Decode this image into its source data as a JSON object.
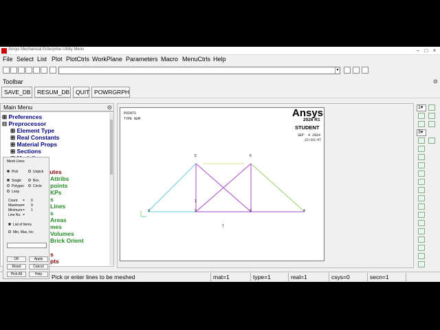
{
  "window": {
    "title": "Ansys Mechanical Enterprise Utility Menu",
    "controls": [
      "–",
      "□",
      "×"
    ]
  },
  "menubar": [
    "File",
    "Select",
    "List",
    "Plot",
    "PlotCtrls",
    "WorkPlane",
    "Parameters",
    "Macro",
    "MenuCtrls",
    "Help"
  ],
  "command_input": {
    "value": ""
  },
  "toolbar": {
    "label": "Toolbar",
    "buttons": [
      "SAVE_DB",
      "RESUM_DB",
      "QUIT",
      "POWRGRPH"
    ]
  },
  "main_menu": {
    "title": "Main Menu",
    "collapse_icon": "⊙",
    "items": [
      {
        "prefix": "⊞",
        "label": "Preferences",
        "color": "#000080"
      },
      {
        "prefix": "⊟",
        "label": "Preprocessor",
        "color": "#000080"
      },
      {
        "prefix": "⊞",
        "label": "Element Type",
        "color": "#000080"
      },
      {
        "prefix": "⊞",
        "label": "Real Constants",
        "color": "#000080"
      },
      {
        "prefix": "⊞",
        "label": "Material Props",
        "color": "#000080"
      },
      {
        "prefix": "⊞",
        "label": "Sections",
        "color": "#000080"
      },
      {
        "prefix": "⊟",
        "label": "Modeling",
        "color": "#000080"
      },
      {
        "prefix": "",
        "label": "butes",
        "color": "#800000"
      },
      {
        "prefix": "",
        "label": "Attribs",
        "color": "#228B22"
      },
      {
        "prefix": "",
        "label": "points",
        "color": "#228B22"
      },
      {
        "prefix": "",
        "label": "KPs",
        "color": "#228B22"
      },
      {
        "prefix": "",
        "label": "s",
        "color": "#228B22"
      },
      {
        "prefix": "",
        "label": "Lines",
        "color": "#228B22"
      },
      {
        "prefix": "",
        "label": "s",
        "color": "#228B22"
      },
      {
        "prefix": "",
        "label": "Areas",
        "color": "#228B22"
      },
      {
        "prefix": "",
        "label": "mes",
        "color": "#228B22"
      },
      {
        "prefix": "",
        "label": "Volumes",
        "color": "#228B22"
      },
      {
        "prefix": "",
        "label": "Brick Orient",
        "color": "#228B22"
      },
      {
        "prefix": "",
        "label": "s",
        "color": "#800000"
      },
      {
        "prefix": "",
        "label": "pts",
        "color": "#800000"
      }
    ]
  },
  "mesh_dialog": {
    "title": "Mesh Lines",
    "pick": "Pick",
    "unpick": "Unpick",
    "single": "Single",
    "box": "Box",
    "polygon": "Polygon",
    "circle": "Circle",
    "loop": "Loop",
    "count_label": "Count",
    "count_value": "0",
    "maximum_label": "Maximum",
    "maximum_value": "9",
    "minimum_label": "Minimum",
    "minimum_value": "1",
    "line_no_label": "Line No.",
    "list_of_items": "List of Items",
    "min_max_inc": "Min, Max, Inc",
    "ok": "OK",
    "apply": "Apply",
    "reset": "Reset",
    "cancel": "Cancel",
    "pick_all": "Pick All",
    "help": "Help"
  },
  "graphics": {
    "top_left_1": "POINTS",
    "top_left_2": "TYPE NUM",
    "brand": "Ansys",
    "version": "2026 R1",
    "edition": "STUDENT",
    "date": "SEP  4 2024",
    "time": "22:03:47",
    "x_label": "X",
    "kp_labels": [
      "1",
      "2",
      "3",
      "4",
      "5",
      "6"
    ]
  },
  "right_toolbar": {
    "window_select": "1",
    "view_select": "3"
  },
  "status": {
    "prompt": "Pick or enter lines to be meshed",
    "mat": "mat=1",
    "type": "type=1",
    "real": "real=1",
    "csys": "csys=0",
    "secn": "secn=1"
  },
  "colors": {
    "line_cyan": "#66ccdd",
    "line_green": "#99cc66",
    "line_magenta": "#aa44cc",
    "line_yellow": "#dddd88",
    "line_orange": "#ddaa66"
  }
}
